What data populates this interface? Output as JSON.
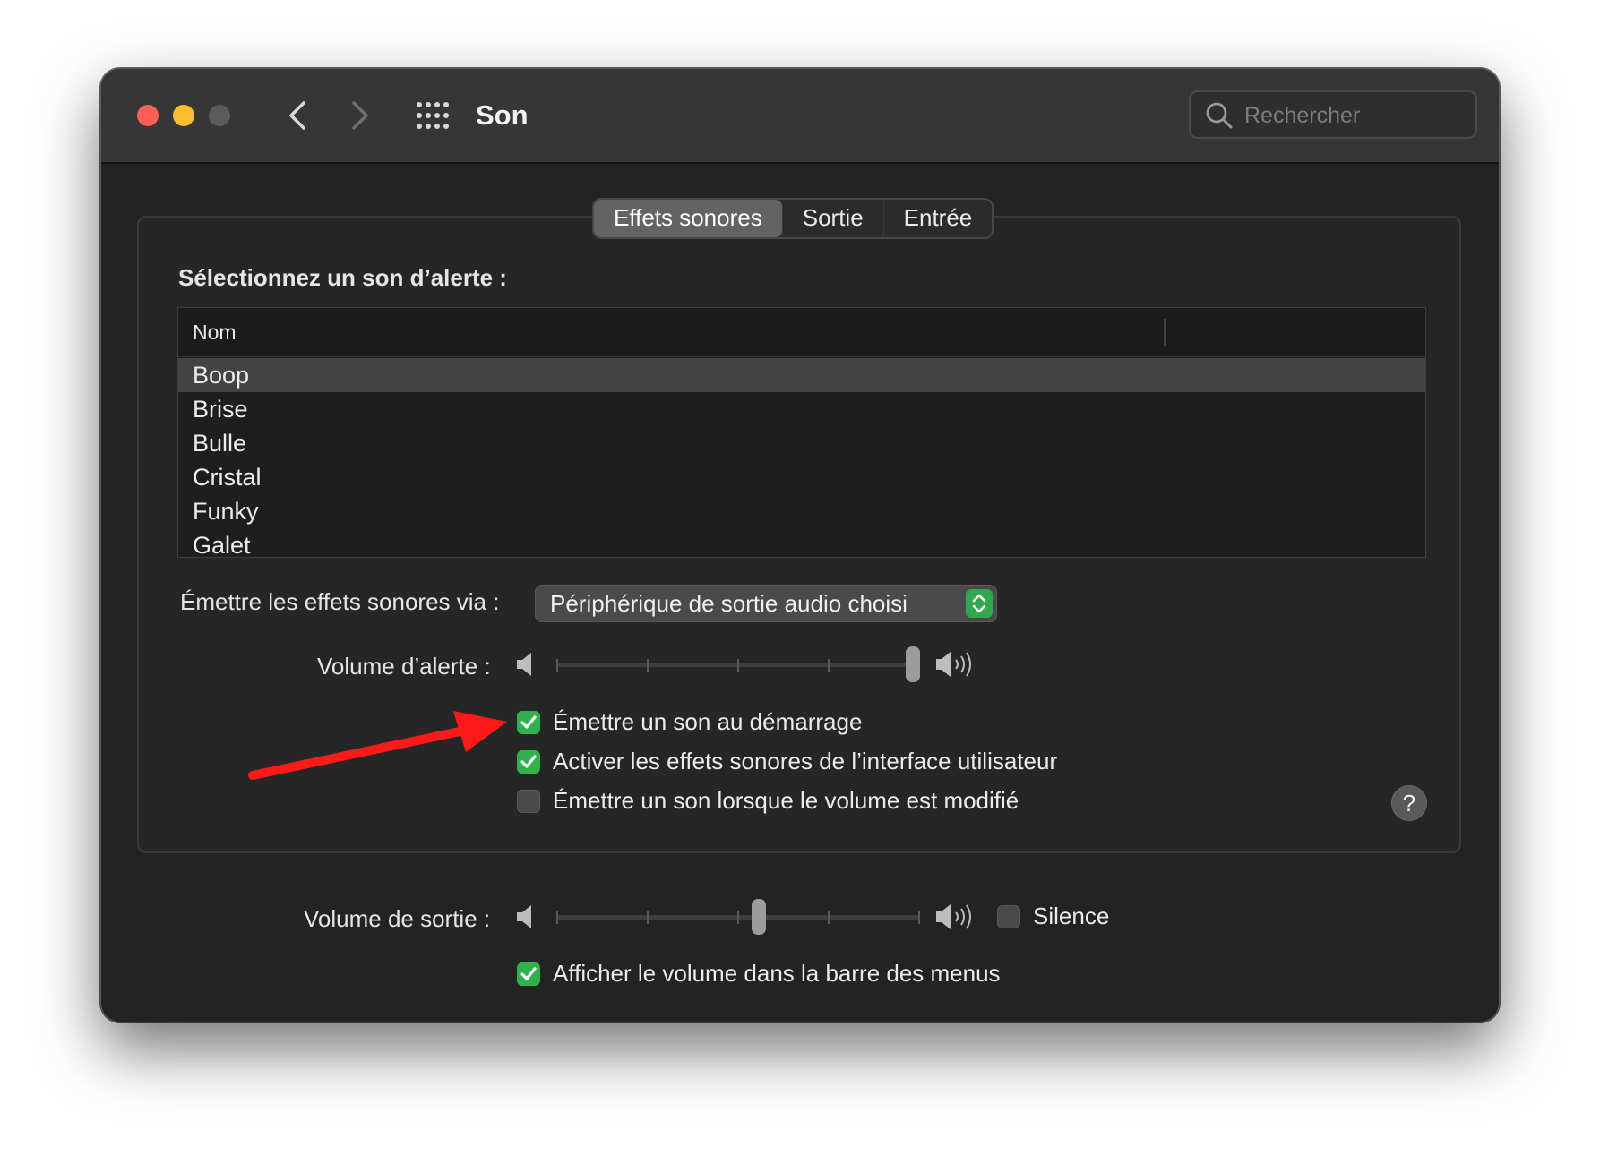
{
  "window": {
    "title": "Son",
    "search_placeholder": "Rechercher"
  },
  "tabs": [
    {
      "label": "Effets sonores",
      "active": true
    },
    {
      "label": "Sortie",
      "active": false
    },
    {
      "label": "Entrée",
      "active": false
    }
  ],
  "alert_section": {
    "label": "Sélectionnez un son d’alerte :",
    "column_header": "Nom",
    "sounds": [
      "Boop",
      "Brise",
      "Bulle",
      "Cristal",
      "Funky",
      "Galet"
    ],
    "selected": "Boop"
  },
  "play_via": {
    "label": "Émettre les effets sonores via :",
    "value": "Périphérique de sortie audio choisi"
  },
  "alert_volume": {
    "label": "Volume d’alerte :",
    "level": 1.0
  },
  "checkboxes": [
    {
      "label": "Émettre un son au démarrage",
      "checked": true
    },
    {
      "label": "Activer les effets sonores de l’interface utilisateur",
      "checked": true
    },
    {
      "label": "Émettre un son lorsque le volume est modifié",
      "checked": false
    }
  ],
  "help_label": "?",
  "output_volume": {
    "label": "Volume de sortie :",
    "level": 0.56
  },
  "mute": {
    "label": "Silence",
    "checked": false
  },
  "show_in_menubar": {
    "label": "Afficher le volume dans la barre des menus",
    "checked": true
  },
  "colors": {
    "accent_green": "#2fb24c",
    "annotation_arrow": "#ff1a1a",
    "close": "#ff5f57",
    "minimize": "#febc2e"
  }
}
